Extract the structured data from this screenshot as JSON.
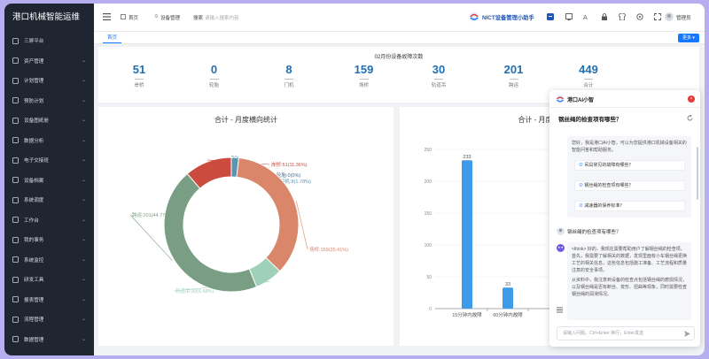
{
  "app": {
    "title": "港口机械智能运维"
  },
  "sidebar": {
    "items": [
      {
        "label": "三屏平台",
        "has_chevron": false
      },
      {
        "label": "资产管理",
        "has_chevron": true
      },
      {
        "label": "计划管理",
        "has_chevron": true
      },
      {
        "label": "预防计划",
        "has_chevron": true
      },
      {
        "label": "设备图纸册",
        "has_chevron": true
      },
      {
        "label": "数据分析",
        "has_chevron": true
      },
      {
        "label": "电子交接班",
        "has_chevron": true
      },
      {
        "label": "设备档案",
        "has_chevron": true
      },
      {
        "label": "系统调度",
        "has_chevron": true
      },
      {
        "label": "工作台",
        "has_chevron": true
      },
      {
        "label": "我的事务",
        "has_chevron": true
      },
      {
        "label": "系统监控",
        "has_chevron": true
      },
      {
        "label": "研发工具",
        "has_chevron": true
      },
      {
        "label": "报表管理",
        "has_chevron": true
      },
      {
        "label": "流程管理",
        "has_chevron": true
      },
      {
        "label": "数据管理",
        "has_chevron": true
      }
    ]
  },
  "topbar": {
    "breadcrumb_home": "首页",
    "breadcrumb_current": "设备管理",
    "search_label": "搜索",
    "search_placeholder": "请输入搜索内容",
    "assistant_label": "NICT设备管理小助手",
    "user_name": "管理员"
  },
  "tabs": {
    "home": "首页",
    "more": "更多"
  },
  "stats": {
    "title": "02月份设备故障次数",
    "items": [
      {
        "value": "51",
        "label": "岸桥"
      },
      {
        "value": "0",
        "label": "轮胎"
      },
      {
        "value": "8",
        "label": "门机"
      },
      {
        "value": "159",
        "label": "场桥"
      },
      {
        "value": "30",
        "label": "轨道吊"
      },
      {
        "value": "201",
        "label": "跨运"
      },
      {
        "value": "449",
        "label": "合计"
      }
    ]
  },
  "pie_panel": {
    "title": "合计 - 月度横向统计"
  },
  "bar_panel": {
    "title": "合计 - 月度横向统计"
  },
  "chart_data": [
    {
      "type": "pie",
      "title": "合计 - 月度横向统计",
      "slices": [
        {
          "name": "岸桥",
          "value": 51,
          "percent": 11.36,
          "label": "岸桥:51(11.36%)",
          "color": "#cc4b3f"
        },
        {
          "name": "轮胎",
          "value": 0,
          "percent": 0,
          "label": "轮胎:0(0%)",
          "color": "#4a6a8a"
        },
        {
          "name": "门机",
          "value": 8,
          "percent": 1.78,
          "label": "门机:8(1.78%)",
          "color": "#5b93b0"
        },
        {
          "name": "场桥",
          "value": 159,
          "percent": 35.41,
          "label": "场桥:159(35.41%)",
          "color": "#d9866a"
        },
        {
          "name": "轨道吊",
          "value": 30,
          "percent": 6.68,
          "label": "轨道吊:30(6.68%)",
          "color": "#9fd1b8"
        },
        {
          "name": "跨运",
          "value": 201,
          "percent": 44.77,
          "label": "跨运:201(44.77%)",
          "color": "#7a9e83"
        }
      ]
    },
    {
      "type": "bar",
      "title": "合计 - 月度横向统计",
      "categories": [
        "15分钟内故障",
        "60分钟内故障"
      ],
      "values": [
        233,
        33
      ],
      "ylim": [
        0,
        250
      ],
      "yticks": [
        0,
        50,
        100,
        150,
        200,
        250
      ],
      "color": "#3d9be9",
      "grid": true
    }
  ],
  "chat": {
    "title": "港口AI小智",
    "question_heading": "钢丝绳的检查项有哪些？",
    "intro_text": "您好，我是港口AI小智，可以为您提供港口机械设备相关的智能问答和帮助服务。",
    "suggestions": [
      "吊具常见的故障有哪些？",
      "钢丝绳的检查项有哪些？",
      "减速器的保养标准？"
    ],
    "user_question": "钢丝绳的检查项有哪些？",
    "answer_p1": "<think> 好的，我现在需要帮助用户了解钢丝绳的检查项。首先，我需要了解相关的数据，发现里面有小车钢丝绳更换工艺的相关信息，这些信息包括施工准备、工艺流程和质量注意的安全事项。",
    "answer_p2": "从资料中，我注意到设备的检查点包括钢丝绳的磨损情况，以及钢丝绳是否有断丝、变形、扭曲等现象，同时需要检查钢丝绳的润滑情况。",
    "input_placeholder": "请输入问题，Ctrl+Enter 换行，Enter发送"
  }
}
